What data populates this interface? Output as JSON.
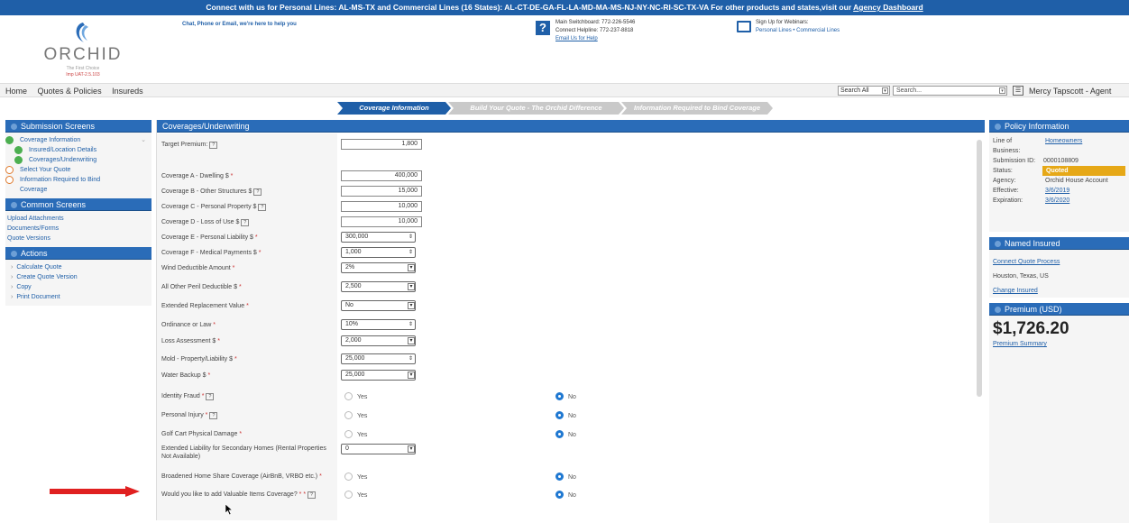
{
  "banner": {
    "text": "Connect with us for Personal Lines: AL-MS-TX and Commercial Lines (16 States): AL-CT-DE-GA-FL-LA-MD-MA-MS-NJ-NY-NC-RI-SC-TX-VA For other products and states,visit our ",
    "link": "Agency Dashboard"
  },
  "header": {
    "logo_name": "ORCHID",
    "logo_tag": "The First Choice",
    "version": "Imp UAT-2.5.103",
    "chat": "Chat, Phone or Email, we're here to help you",
    "main_switchboard": "Main Switchboard: 772-226-5546",
    "connect_helpline": "Connect Helpline:  772-237-8818",
    "email_help": "Email Us for Help",
    "webinars": "Sign Up for Webinars:",
    "webinar_links": "Personal Lines • Commercial Lines"
  },
  "nav": {
    "home": "Home",
    "quotes": "Quotes & Policies",
    "insureds": "Insureds",
    "search_scope": "Search All",
    "search_placeholder": "Search...",
    "user": "Mercy Tapscott - Agent"
  },
  "steps": [
    "Coverage Information",
    "Build Your Quote - The Orchid Difference",
    "Information Required to Bind Coverage"
  ],
  "left": {
    "submission_title": "Submission Screens",
    "submission_items": [
      "Coverage Information",
      "Insured/Location Details",
      "Coverages/Underwriting",
      "Select Your Quote",
      "Information Required to Bind",
      "Coverage"
    ],
    "common_title": "Common Screens",
    "common_items": [
      "Upload Attachments",
      "Documents/Forms",
      "Quote Versions"
    ],
    "actions_title": "Actions",
    "actions": [
      "Calculate Quote",
      "Create Quote Version",
      "Copy",
      "Print Document"
    ]
  },
  "main": {
    "title": "Coverages/Underwriting",
    "target_premium_label": "Target Premium:",
    "target_premium": "1,800",
    "cov_a_label": "Coverage A - Dwelling $",
    "cov_a": "400,000",
    "cov_b_label": "Coverage B - Other Structures $",
    "cov_b": "15,000",
    "cov_c_label": "Coverage C - Personal Property $",
    "cov_c": "10,000",
    "cov_d_label": "Coverage D - Loss of Use $",
    "cov_d": "10,000",
    "cov_e_label": "Coverage E - Personal Liability $",
    "cov_e": "300,000",
    "cov_f_label": "Coverage F - Medical Payments $",
    "cov_f": "1,000",
    "wind_label": "Wind Deductible Amount",
    "wind": "2%",
    "aop_label": "All Other Peril Deductible $",
    "aop": "2,500",
    "erv_label": "Extended Replacement Value",
    "erv": "No",
    "ord_label": "Ordinance or Law",
    "ord": "10%",
    "loss_label": "Loss Assessment $",
    "loss": "2,000",
    "mold_label": "Mold - Property/Liability $",
    "mold": "25,000",
    "water_label": "Water Backup $",
    "water": "25,000",
    "idfraud_label": "Identity Fraud",
    "pinj_label": "Personal Injury",
    "golf_label": "Golf Cart Physical Damage",
    "extliab_label": "Extended Liability for Secondary Homes (Rental Properties Not Available)",
    "extliab": "0",
    "broad_label": "Broadened Home Share Coverage (AirBnB, VRBO etc.)",
    "valuable_label": "Would you like to add Valuable Items Coverage?",
    "yes": "Yes",
    "no": "No"
  },
  "right": {
    "policy_title": "Policy Information",
    "lob_label": "Line of Business:",
    "lob": "Homeowners",
    "sub_id_label": "Submission ID:",
    "sub_id": "0000108809",
    "status_label": "Status:",
    "status": "Quoted",
    "agency_label": "Agency:",
    "agency": "Orchid House Account",
    "eff_label": "Effective:",
    "eff": "3/6/2019",
    "exp_label": "Expiration:",
    "exp": "3/6/2020",
    "named_title": "Named Insured",
    "connect": "Connect Quote Process",
    "location": "Houston, Texas, US",
    "change": "Change Insured",
    "premium_title": "Premium (USD)",
    "premium": "$1,726.20",
    "summary": "Premium Summary"
  },
  "colors": {
    "brand": "#1f5fa8",
    "status": "#e6a817",
    "arrow": "#e02020"
  }
}
